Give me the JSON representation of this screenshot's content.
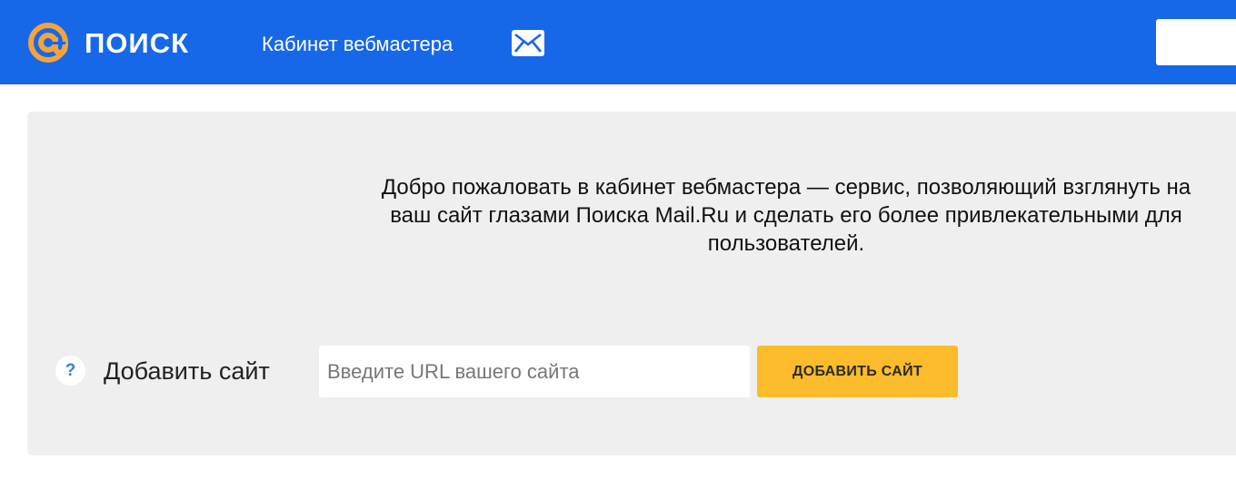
{
  "header": {
    "logo_text": "ПОИСК",
    "cabinet_link": "Кабинет вебмастера",
    "mail_icon": "mail-envelope-icon",
    "logo_icon": "at-sign-icon",
    "colors": {
      "header_bg": "#1767e9",
      "logo_accent": "#f5a33b"
    }
  },
  "main": {
    "welcome_text": "Добро пожаловать в кабинет вебмастера — сервис, позволяющий взглянуть на ваш сайт глазами Поиска Mail.Ru и сделать его более привлекательными для пользователей.",
    "add_site": {
      "help_icon": "question-icon",
      "help_glyph": "?",
      "label": "Добавить сайт",
      "input_value": "",
      "input_placeholder": "Введите URL вашего сайта",
      "button_label": "ДОБАВИТЬ САЙТ",
      "button_color": "#fbbb2a"
    },
    "panel_color": "#efefef"
  }
}
